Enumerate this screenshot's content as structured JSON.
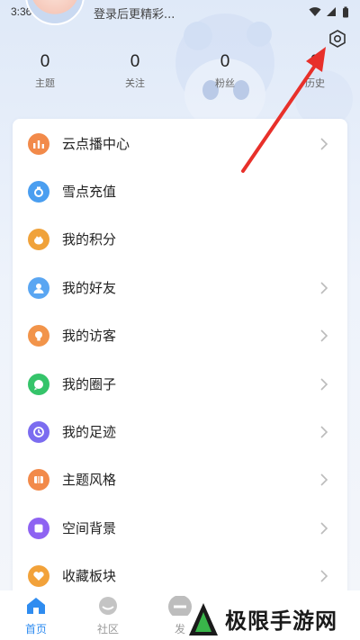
{
  "status_bar": {
    "time": "3:36"
  },
  "header": {
    "login_hint": "登录后更精彩..."
  },
  "stats": [
    {
      "value": "0",
      "label": "主题"
    },
    {
      "value": "0",
      "label": "关注"
    },
    {
      "value": "0",
      "label": "粉丝"
    },
    {
      "value": "0",
      "label": "历史"
    }
  ],
  "menu": [
    {
      "label": "云点播中心",
      "icon": "bar-chart-icon",
      "color": "#f28a4a",
      "chevron": true
    },
    {
      "label": "雪点充值",
      "icon": "ring-icon",
      "color": "#4a9ef0",
      "chevron": false
    },
    {
      "label": "我的积分",
      "icon": "bag-icon",
      "color": "#f0a23a",
      "chevron": false
    },
    {
      "label": "我的好友",
      "icon": "user-icon",
      "color": "#5aa6f2",
      "chevron": true
    },
    {
      "label": "我的访客",
      "icon": "bulb-icon",
      "color": "#f2944a",
      "chevron": true
    },
    {
      "label": "我的圈子",
      "icon": "chat-icon",
      "color": "#35c46a",
      "chevron": true
    },
    {
      "label": "我的足迹",
      "icon": "clock-icon",
      "color": "#7b6cf0",
      "chevron": true
    },
    {
      "label": "主题风格",
      "icon": "theme-icon",
      "color": "#f28a4a",
      "chevron": true
    },
    {
      "label": "空间背景",
      "icon": "square-icon",
      "color": "#8e63f2",
      "chevron": true
    },
    {
      "label": "收藏板块",
      "icon": "heart-icon",
      "color": "#f2a23a",
      "chevron": true
    }
  ],
  "bottom_nav": [
    {
      "label": "首页",
      "icon": "home-icon",
      "active": true
    },
    {
      "label": "社区",
      "icon": "community-icon",
      "active": false
    },
    {
      "label": "发",
      "icon": "post-icon",
      "active": false
    }
  ],
  "watermark": {
    "text": "极限手游网"
  },
  "colors": {
    "accent": "#2f8cf0",
    "arrow": "#e8302a"
  }
}
